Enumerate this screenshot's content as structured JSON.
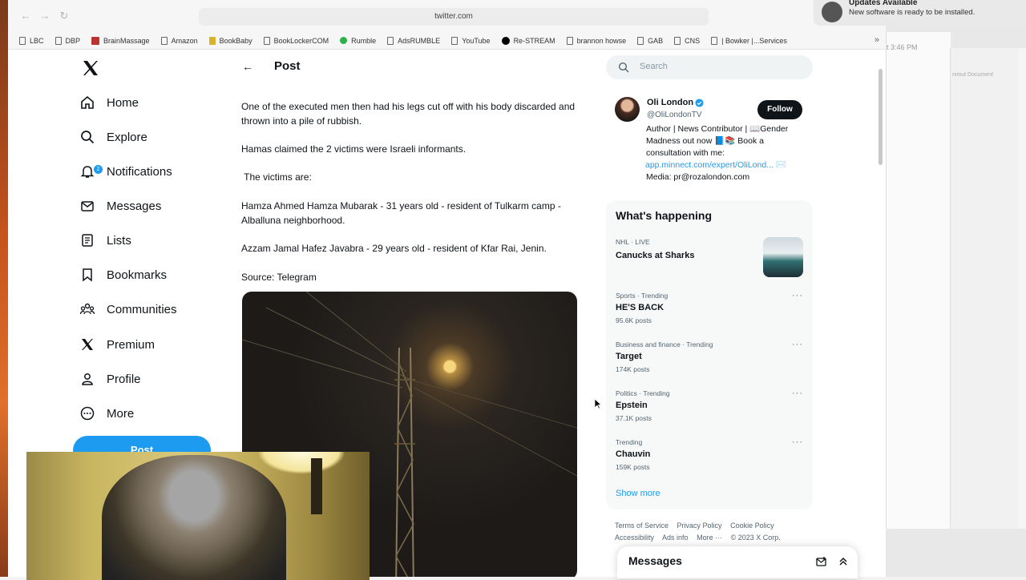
{
  "browser": {
    "url": "twitter.com",
    "bookmarks": [
      "LBC",
      "DBP",
      "BrainMassage",
      "Amazon",
      "BookBaby",
      "BookLockerCOM",
      "Rumble",
      "AdsRUMBLE",
      "YouTube",
      "Re-STREAM",
      "brannon howse",
      "GAB",
      "CNS",
      "| Bowker |...Services"
    ],
    "more_chevron": "»"
  },
  "notification": {
    "title": "Updates Available",
    "body": "New software is ready to be installed."
  },
  "background_window": {
    "time": "t 3:46 PM",
    "tabs": "nimut   Document"
  },
  "sidebar": {
    "items": [
      {
        "label": "Home",
        "icon": "home-icon"
      },
      {
        "label": "Explore",
        "icon": "search-icon"
      },
      {
        "label": "Notifications",
        "icon": "bell-icon",
        "badge": "2"
      },
      {
        "label": "Messages",
        "icon": "envelope-icon"
      },
      {
        "label": "Lists",
        "icon": "list-icon"
      },
      {
        "label": "Bookmarks",
        "icon": "bookmark-icon"
      },
      {
        "label": "Communities",
        "icon": "people-icon"
      },
      {
        "label": "Premium",
        "icon": "x-icon"
      },
      {
        "label": "Profile",
        "icon": "person-icon"
      },
      {
        "label": "More",
        "icon": "more-circle-icon"
      }
    ],
    "post_button": "Post"
  },
  "post": {
    "header_title": "Post",
    "paragraphs": [
      "One of the executed men then had his legs cut off with his body discarded and thrown into a pile of rubbish.",
      "Hamas claimed the 2 victims were Israeli informants.",
      " The victims are:",
      "Hamza Ahmed Hamza Mubarak - 31 years old - resident of Tulkarm camp - Alballuna neighborhood.",
      "Azzam Jamal Hafez Javabra - 29 years old - resident of Kfar Rai, Jenin.",
      "Source: Telegram"
    ]
  },
  "search": {
    "placeholder": "Search"
  },
  "profile_card": {
    "name": "Oli London",
    "handle": "@OliLondonTV",
    "follow": "Follow",
    "bio_line1": "Author | News Contributor | 📖Gender",
    "bio_line2": "Madness out now 📘📚 Book a",
    "bio_line3": "consultation with me:",
    "bio_link": "app.minnect.com/expert/OliLond... ✉️",
    "bio_line5": "Media: pr@rozalondon.com"
  },
  "whats_happening": {
    "title": "What's happening",
    "trends": [
      {
        "meta": "NHL · LIVE",
        "name": "Canucks at Sharks",
        "count": ""
      },
      {
        "meta": "Sports · Trending",
        "name": "HE'S BACK",
        "count": "95.6K posts"
      },
      {
        "meta": "Business and finance · Trending",
        "name": "Target",
        "count": "174K posts"
      },
      {
        "meta": "Politics · Trending",
        "name": "Epstein",
        "count": "37.1K posts"
      },
      {
        "meta": "Trending",
        "name": "Chauvin",
        "count": "159K posts"
      }
    ],
    "show_more": "Show more",
    "dots": "···"
  },
  "footer": {
    "row1": [
      "Terms of Service",
      "Privacy Policy",
      "Cookie Policy"
    ],
    "row2": [
      "Accessibility",
      "Ads info",
      "More ···",
      "© 2023 X Corp."
    ]
  },
  "messages_drawer": {
    "title": "Messages"
  }
}
